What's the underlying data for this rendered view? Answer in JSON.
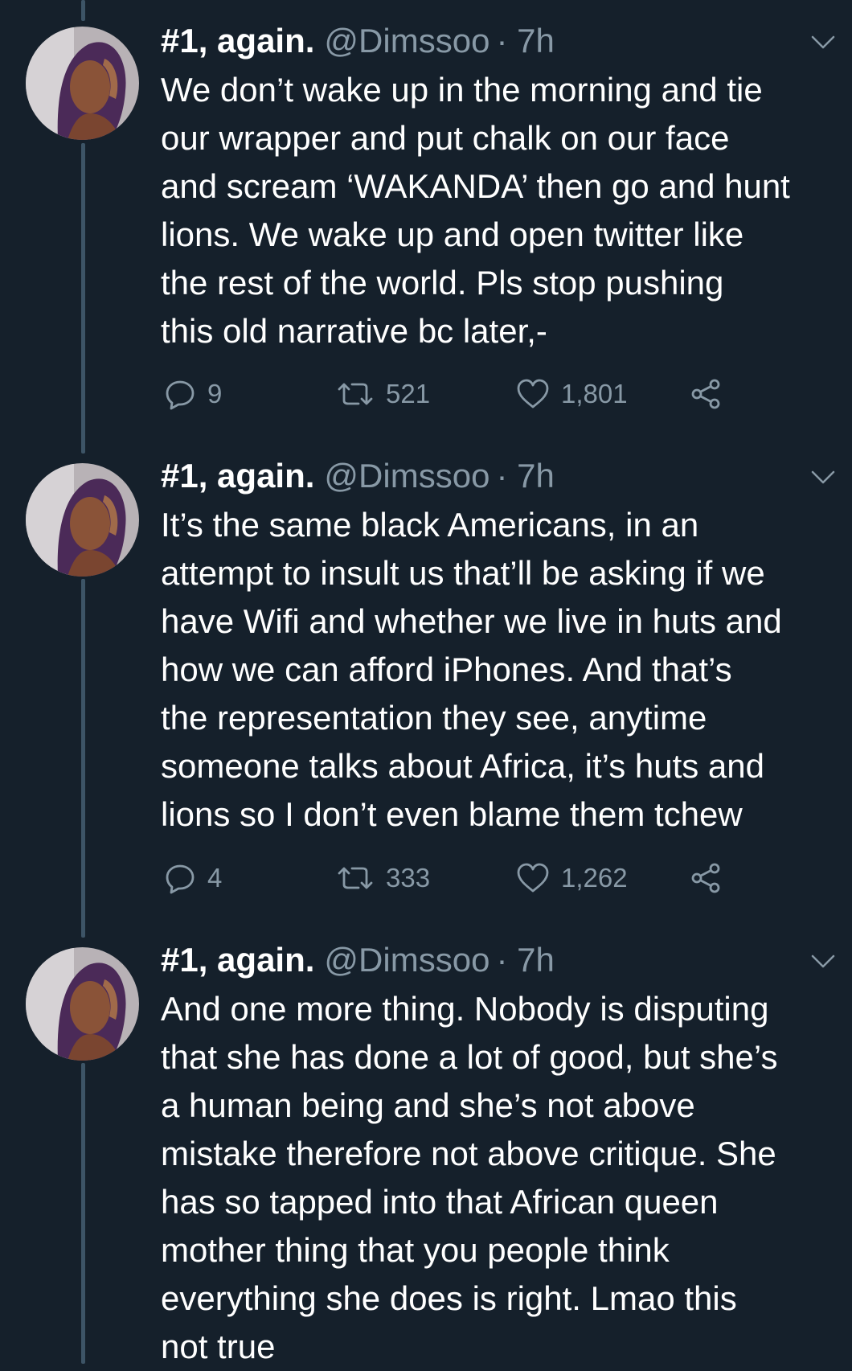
{
  "tweets": [
    {
      "display_name": "#1, again.",
      "handle": "@Dimssoo",
      "time": "· 7h",
      "text": "We don’t wake up in the morning and tie\nour wrapper and put chalk on our face\nand scream ‘WAKANDA’ then go and hunt\nlions. We wake up and open twitter like\nthe rest of the world. Pls stop pushing\nthis old narrative bc later,-",
      "replies": "9",
      "retweets": "521",
      "likes": "1,801"
    },
    {
      "display_name": "#1, again.",
      "handle": "@Dimssoo",
      "time": "· 7h",
      "text": "It’s the same black Americans, in an\nattempt to insult us that’ll be asking if we\nhave Wifi and whether we live in huts and\nhow we can afford iPhones. And that’s\nthe representation they see, anytime\nsomeone talks about Africa, it’s huts and\nlions so I don’t even blame them tchew",
      "replies": "4",
      "retweets": "333",
      "likes": "1,262"
    },
    {
      "display_name": "#1, again.",
      "handle": "@Dimssoo",
      "time": "· 7h",
      "text": "And one more thing. Nobody is disputing\nthat she has done a lot of good, but she’s\na human being and she’s not above\nmistake therefore not above critique. She\nhas so tapped into that African queen\nmother thing that you people think\neverything she does is right. Lmao this\nnot true"
    }
  ],
  "icons": {
    "reply": "speech-bubble-icon",
    "retweet": "retweet-arrows-icon",
    "like": "heart-icon",
    "share": "share-nodes-icon",
    "more": "chevron-down-icon"
  },
  "colors": {
    "background": "#15202b",
    "text": "#ffffff",
    "secondary": "#8899a6",
    "thread_line": "#3d5466"
  }
}
